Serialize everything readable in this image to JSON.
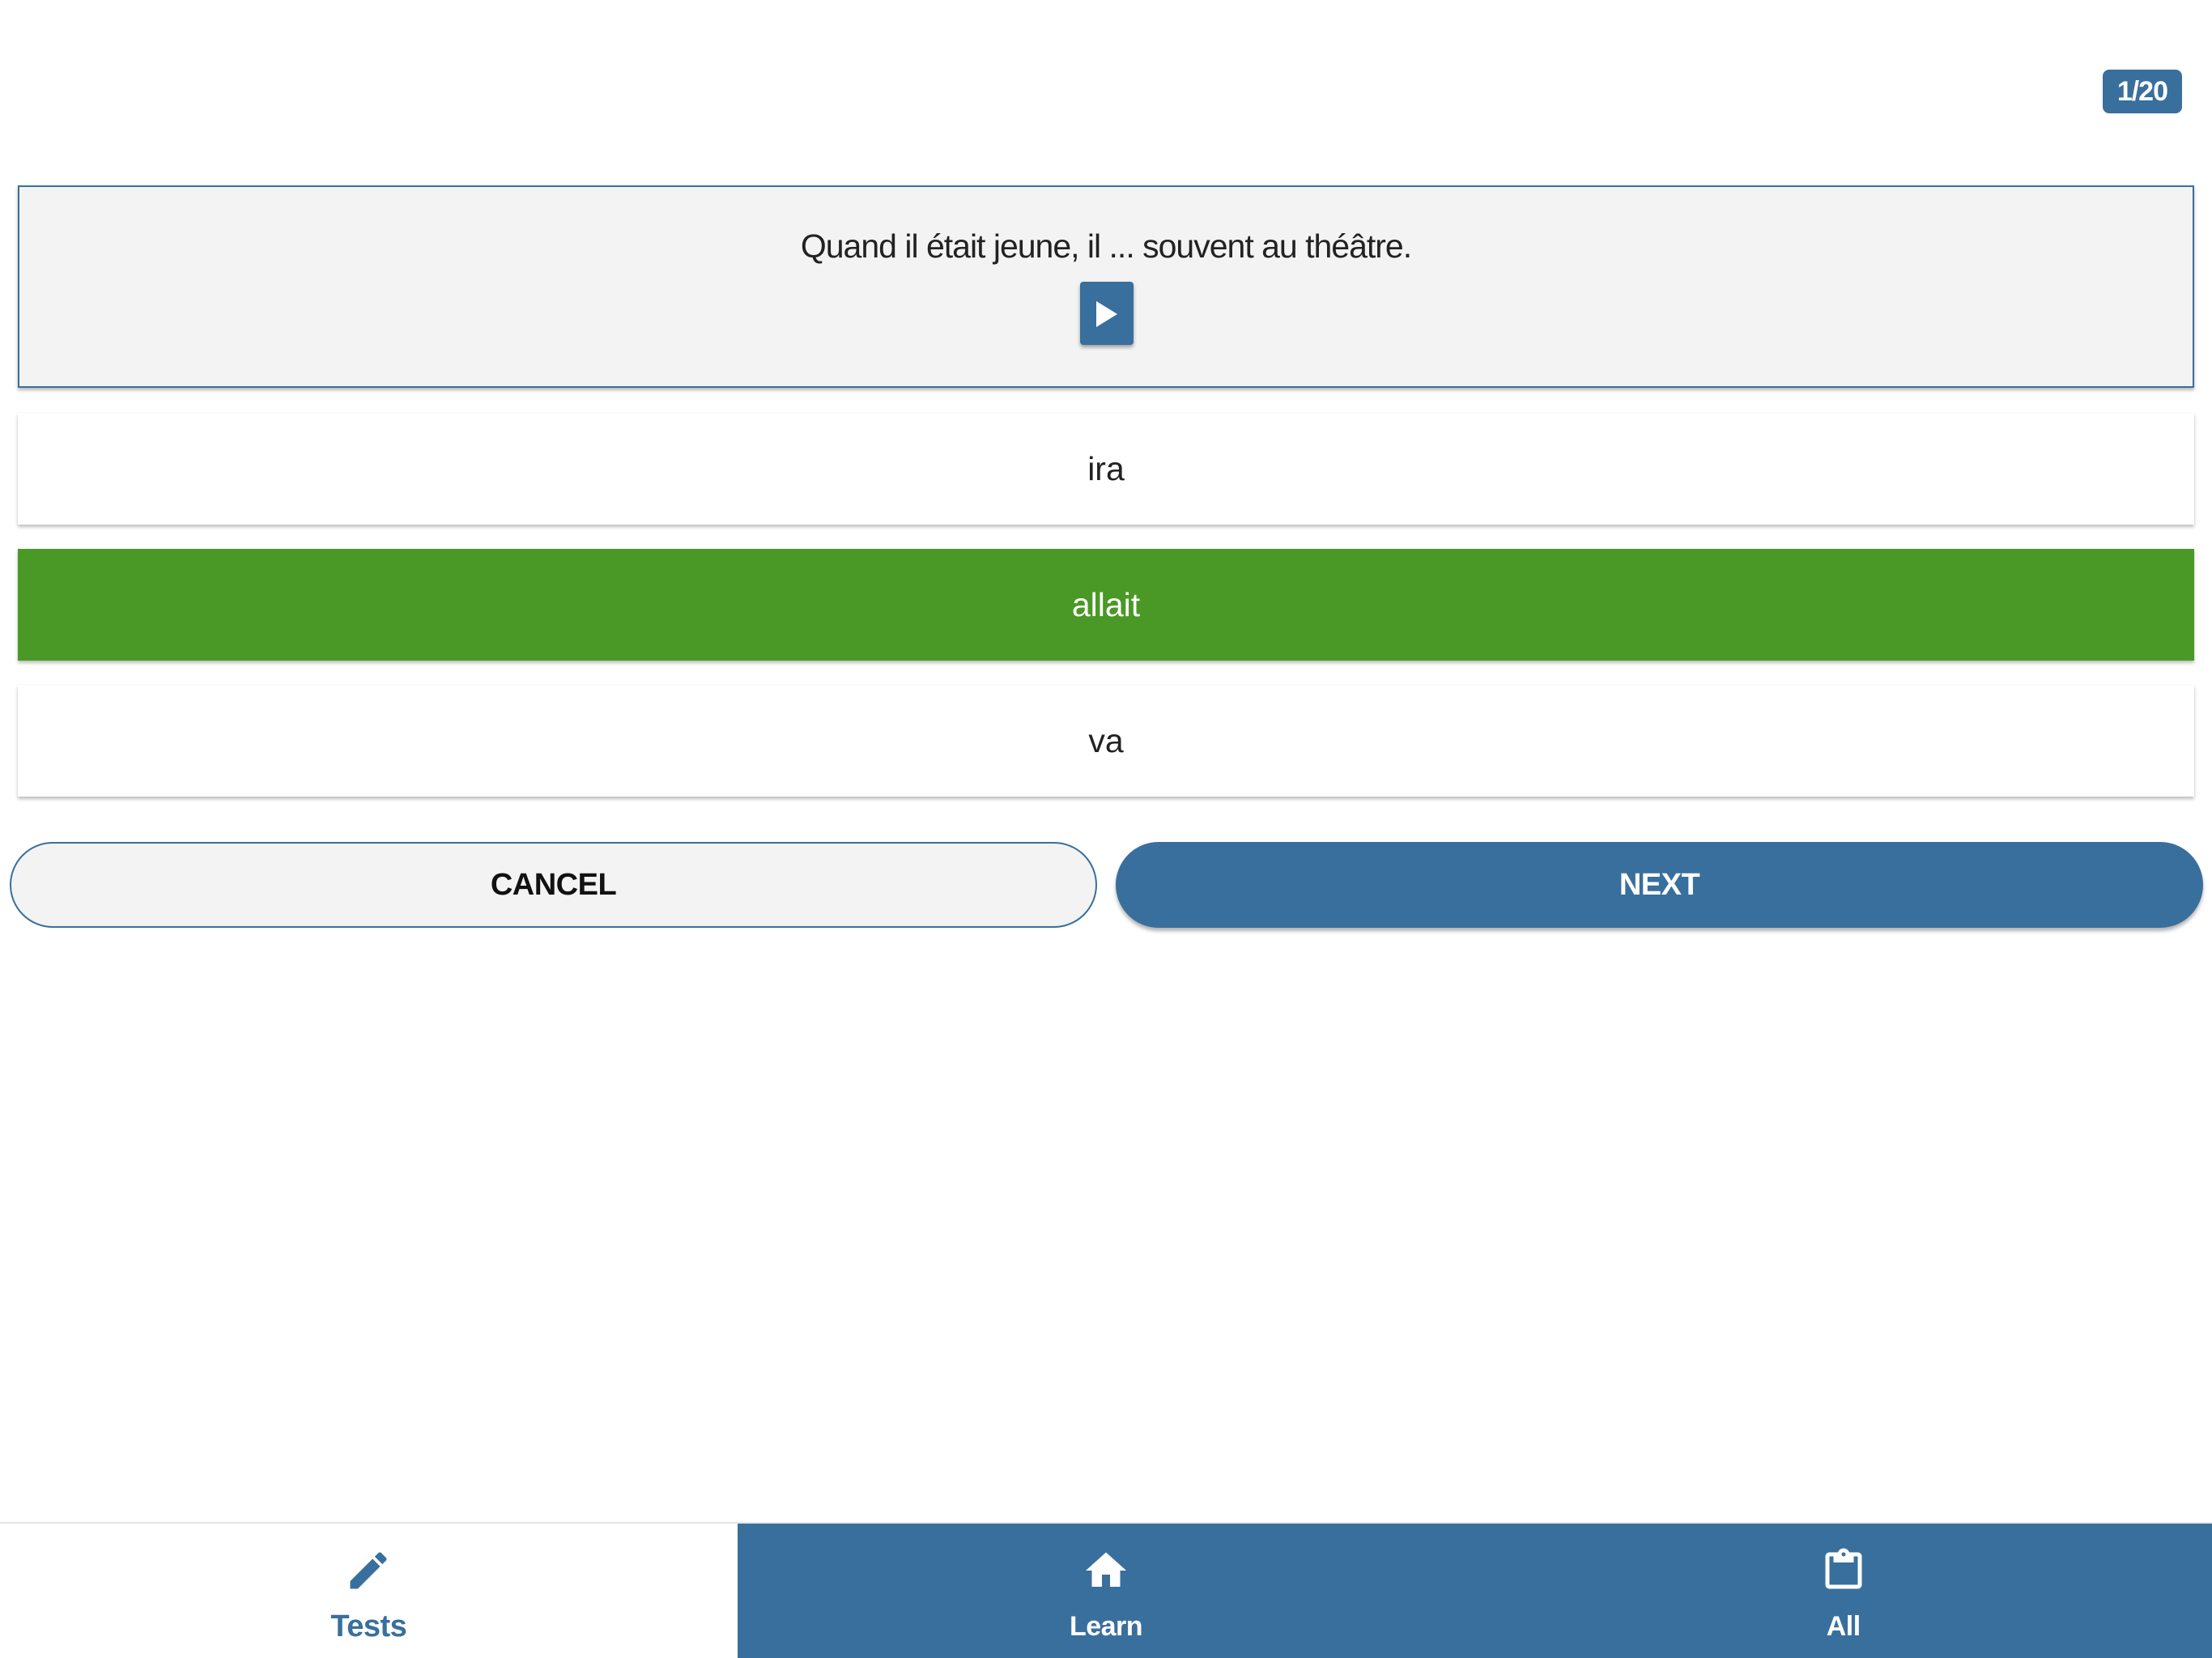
{
  "progress": {
    "label": "1/20",
    "current": 1,
    "total": 20
  },
  "question": {
    "text": "Quand il était jeune, il ... souvent au théâtre.",
    "play_icon": "play-icon"
  },
  "answers": [
    {
      "label": "ira",
      "state": "default"
    },
    {
      "label": "allait",
      "state": "correct"
    },
    {
      "label": "va",
      "state": "default"
    }
  ],
  "actions": {
    "cancel_label": "CANCEL",
    "next_label": "NEXT"
  },
  "bottom_nav": {
    "tabs": [
      {
        "label": "Tests",
        "icon": "pencil-icon",
        "active": true
      },
      {
        "label": "Learn",
        "icon": "home-icon",
        "active": false
      },
      {
        "label": "All",
        "icon": "clipboard-icon",
        "active": false
      }
    ]
  },
  "colors": {
    "primary": "#386f9d",
    "correct": "#4a9826",
    "card_background": "#f3f3f3"
  }
}
